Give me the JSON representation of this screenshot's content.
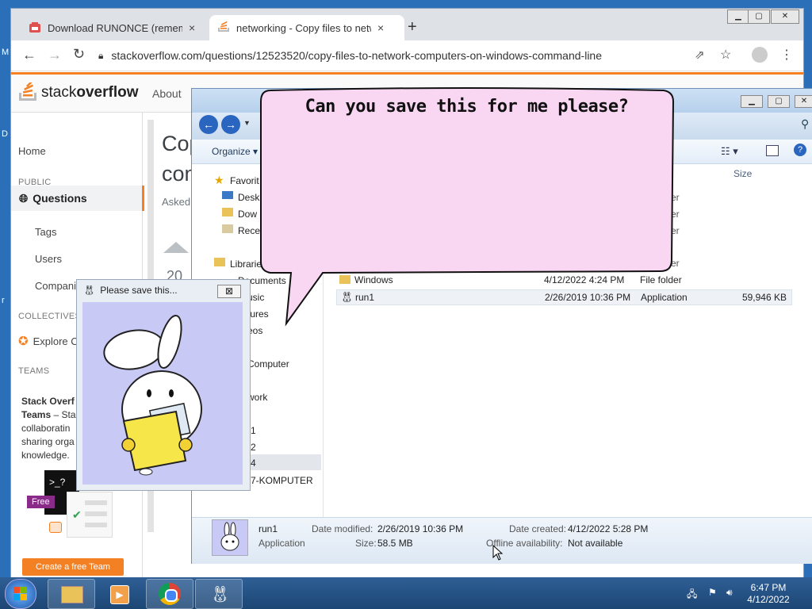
{
  "desktop": {
    "left_edge_letters": [
      "M",
      "D",
      "r"
    ]
  },
  "browser": {
    "tabs": [
      {
        "label": "Download RUNONCE (remember",
        "close": "×"
      },
      {
        "label": "networking - Copy files to netwo",
        "close": "×"
      }
    ],
    "new_tab": "+",
    "url": "stackoverflow.com/questions/12523520/copy-files-to-network-computers-on-windows-command-line"
  },
  "so": {
    "logo_stack": "stack",
    "logo_overflow": "overflow",
    "about": "About",
    "title_frag1": "Cop",
    "title_frag2": "con",
    "asked": "Asked",
    "vote": "20",
    "sidebar": {
      "home": "Home",
      "public": "PUBLIC",
      "questions": "Questions",
      "tags": "Tags",
      "users": "Users",
      "companies": "Companies",
      "collectives": "COLLECTIVES",
      "explore": "Explore C",
      "teams": "TEAMS",
      "teams_title1": "Stack Overf",
      "teams_title2": "Teams",
      "teams_desc1": "– Sta",
      "teams_desc2": "collaboratin",
      "teams_desc3": "sharing orga",
      "teams_desc4": "knowledge.",
      "free": "Free",
      "prompt": ">_?",
      "create_team": "Create a free Team"
    }
  },
  "explorer": {
    "organize": "Organize",
    "column_size": "Size",
    "nav": {
      "favorites": "Favorit",
      "desktop": "Desk",
      "downloads": "Dow",
      "recent": "Rece",
      "libraries": "Librarie",
      "documents": "Documents",
      "music": "usic",
      "pictures": "tures",
      "videos": "eos",
      "computer": "Computer",
      "network": "work",
      "n1": "1",
      "n2": "2",
      "n4": "4",
      "komputer": "7-KOMPUTER"
    },
    "partial_rows": [
      "er",
      "er",
      "er",
      "er"
    ],
    "files": [
      {
        "name": "Windows",
        "date": "4/12/2022 4:24 PM",
        "type": "File folder",
        "size": ""
      },
      {
        "name": "run1",
        "date": "2/26/2019 10:36 PM",
        "type": "Application",
        "size": "59,946 KB"
      }
    ],
    "details": {
      "name": "run1",
      "kind": "Application",
      "modified_label": "Date modified:",
      "modified_value": "2/26/2019 10:36 PM",
      "size_label": "Size:",
      "size_value": "58.5 MB",
      "created_label": "Date created:",
      "created_value": "4/12/2022 5:28 PM",
      "offline_label": "Offline availability:",
      "offline_value": "Not available"
    }
  },
  "bubble": {
    "text": "Can you save this for me please?"
  },
  "mascot": {
    "title": "Please save this...",
    "close": "⊠"
  },
  "taskbar": {
    "time": "6:47 PM",
    "date": "4/12/2022"
  }
}
